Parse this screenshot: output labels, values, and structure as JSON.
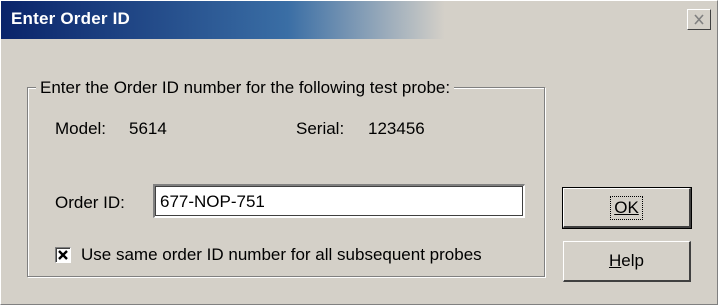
{
  "dialog": {
    "title": "Enter Order ID"
  },
  "group": {
    "legend": "Enter the Order ID number for the following test probe:"
  },
  "probe": {
    "model_label": "Model:",
    "model_value": "5614",
    "serial_label": "Serial:",
    "serial_value": "123456"
  },
  "order": {
    "label": "Order ID:",
    "value": "677-NOP-751"
  },
  "checkbox": {
    "label": "Use same order ID number for all subsequent probes",
    "checked": true
  },
  "buttons": {
    "ok_label": "OK",
    "help_label": "Help"
  },
  "colors": {
    "title_start": "#0a246a",
    "title_mid": "#3a6ea5",
    "face": "#d4d0c8"
  },
  "icons": {
    "close": "close-icon",
    "check": "check-icon"
  }
}
